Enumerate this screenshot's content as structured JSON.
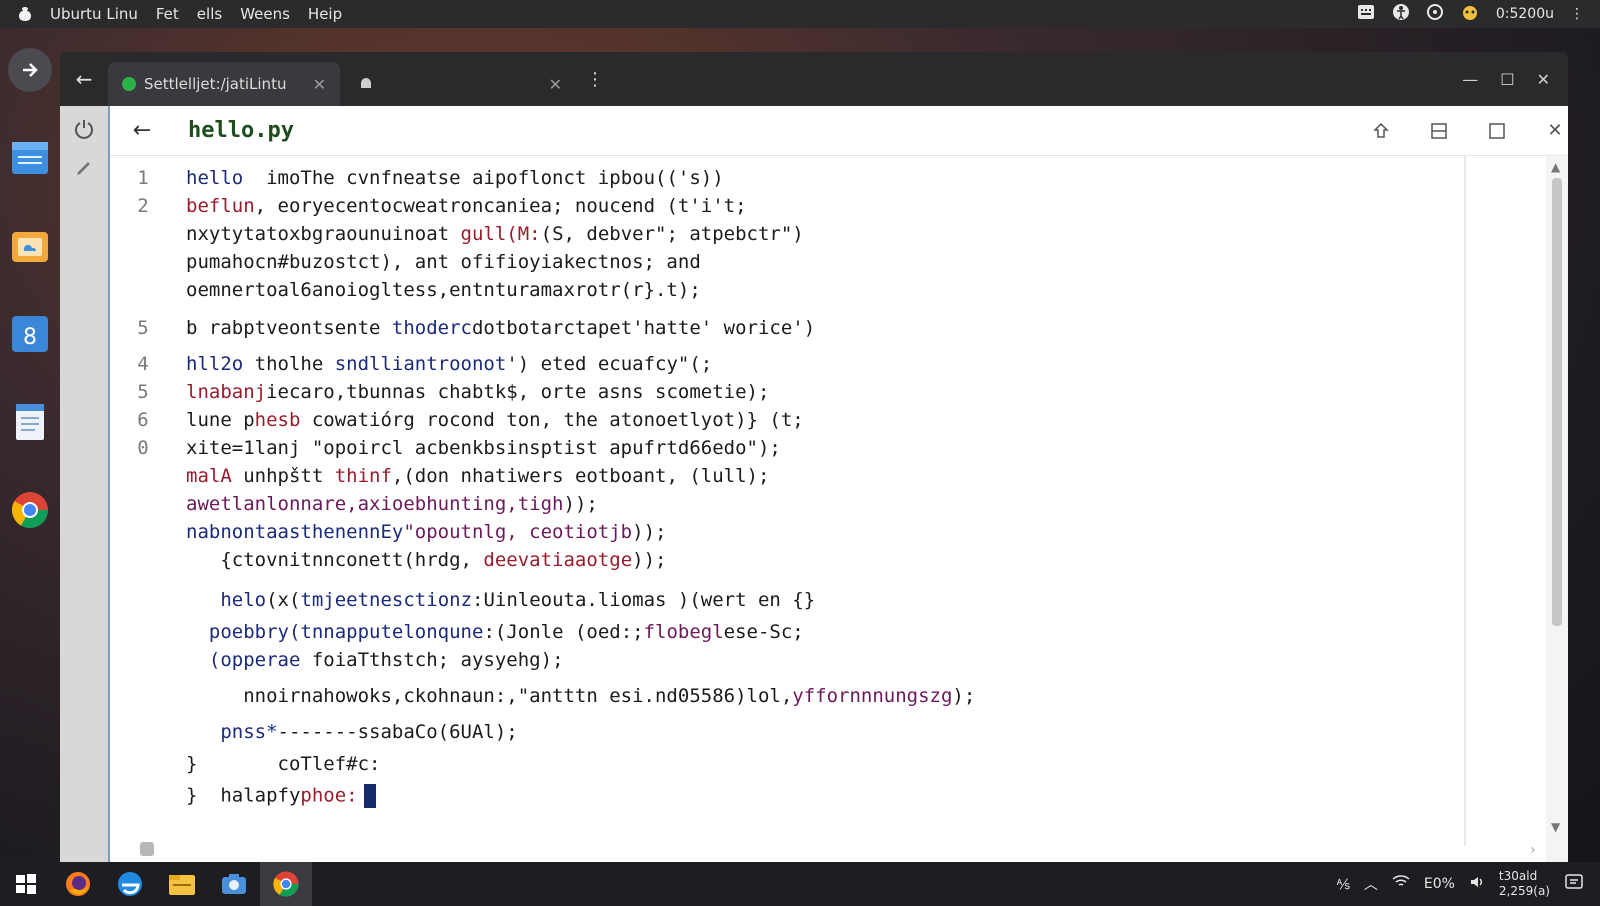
{
  "topbar": {
    "menu": [
      "Uburtu Linu",
      "Fet",
      "ells",
      "Weens",
      "Heip"
    ],
    "clock": "0:5200u"
  },
  "window": {
    "tabs": [
      {
        "label": "Settlelljet:/jatiLintu",
        "active": true
      },
      {
        "label": "",
        "active": false
      }
    ]
  },
  "editor": {
    "filename": "hello.py",
    "lines": [
      {
        "num": "1",
        "parts": [
          [
            "kw",
            "hello"
          ],
          [
            "",
            "  imoThe cvnfneatse aipoflonct ipbou(('s))"
          ]
        ]
      },
      {
        "num": "2",
        "parts": [
          [
            "fn",
            "beflun"
          ],
          [
            "",
            ", eoryecentocweatroncaniea; noucend (t'i't;"
          ]
        ]
      },
      {
        "num": "",
        "parts": [
          [
            "",
            "nxytytatoxbgraounuinoat "
          ],
          [
            "fn",
            "gull(M:"
          ],
          [
            "",
            "(S, debver\"; atpebctr\")"
          ]
        ]
      },
      {
        "num": "",
        "parts": [
          [
            "",
            "pumahocn#buzostct), ant ofifioyiakectnos; and"
          ]
        ]
      },
      {
        "num": "",
        "parts": [
          [
            "",
            "oemnertoal6anoiogltess,entnturamaxrotr(r}.t);"
          ]
        ]
      },
      {
        "num": "5",
        "parts": [
          [
            "",
            "b rabptveontsente "
          ],
          [
            "kw",
            "thoderc"
          ],
          [
            "",
            "dotbotarctapet'hatte' worice')"
          ]
        ]
      },
      {
        "num": "4",
        "parts": [
          [
            "kw",
            "hll2o"
          ],
          [
            "",
            " tholhe "
          ],
          [
            "kw",
            "sndlliantroonot"
          ],
          [
            "",
            "') eted ecuafcy\"(;"
          ]
        ]
      },
      {
        "num": "5",
        "parts": [
          [
            "fn",
            "lnabanj"
          ],
          [
            "",
            "iecaro,tbunnas chabtk$, orte asns scometie);"
          ]
        ]
      },
      {
        "num": "6",
        "parts": [
          [
            "",
            "lune p"
          ],
          [
            "fn",
            "hesb"
          ],
          [
            "",
            " cowatiórg rocond ton, the atonoetlyot)} (t;"
          ]
        ]
      },
      {
        "num": "0",
        "parts": [
          [
            "",
            "xite=1lanj \"opoircl acbenkbsinsptist apufrtd66edo\");"
          ]
        ]
      },
      {
        "num": "",
        "parts": [
          [
            "fn",
            "malA"
          ],
          [
            "",
            " unhpštt "
          ],
          [
            "fn",
            "thinf"
          ],
          [
            "",
            ",(don nhatiwers eotboant, (lull);"
          ]
        ]
      },
      {
        "num": "",
        "parts": [
          [
            "str",
            "awetlanlonnare,axioebhunting,tigh"
          ],
          [
            "",
            "));"
          ]
        ]
      },
      {
        "num": "",
        "parts": [
          [
            "kw",
            "nabnontaasthenennEy"
          ],
          [
            "str",
            "\"opoutnlg, ceotiotjb"
          ],
          [
            "",
            "));"
          ]
        ]
      },
      {
        "num": "",
        "parts": [
          [
            "",
            "   {ctovnitnnconett(hrdg, "
          ],
          [
            "fn",
            "deevatiaaotge"
          ],
          [
            "",
            "));"
          ]
        ]
      },
      {
        "num": "",
        "parts": [
          [
            "",
            "   "
          ],
          [
            "kw",
            "helo"
          ],
          [
            "",
            "(x("
          ],
          [
            "kw",
            "tmjeetnesctionz"
          ],
          [
            "",
            ":Uinleouta.liomas )(wert en {}"
          ]
        ]
      },
      {
        "num": "",
        "parts": [
          [
            "",
            "  "
          ],
          [
            "kw",
            "poebbry(tnnapputelonqune"
          ],
          [
            "",
            ":(Jonle (oed:;"
          ],
          [
            "str",
            "flobegl"
          ],
          [
            "",
            "ese-Sc;"
          ]
        ]
      },
      {
        "num": "",
        "parts": [
          [
            "",
            "  "
          ],
          [
            "kw",
            "(opperae"
          ],
          [
            "",
            " foiaTthstch; aysyehg);"
          ]
        ]
      },
      {
        "num": "",
        "parts": [
          [
            "",
            "     nnoirnahowoks,ckohnaun:,\"antttn esi.nd05586)lol,"
          ],
          [
            "str",
            "yffornnnungszg"
          ],
          [
            "",
            ");"
          ]
        ]
      },
      {
        "num": "",
        "parts": [
          [
            "",
            "   "
          ],
          [
            "kw",
            "pnss*"
          ],
          [
            "",
            "-------ssabaCo(6UAl);"
          ]
        ]
      },
      {
        "num": "",
        "parts": [
          [
            "",
            "}       coTlef#c:"
          ]
        ]
      },
      {
        "num": "",
        "parts": [
          [
            "",
            "}  halapfy"
          ],
          [
            "fn",
            "phoe:"
          ]
        ]
      }
    ]
  },
  "taskbar": {
    "tray_text": [
      "E0%"
    ],
    "clock_line1": "t30ald",
    "clock_line2": "2,259(a)"
  }
}
